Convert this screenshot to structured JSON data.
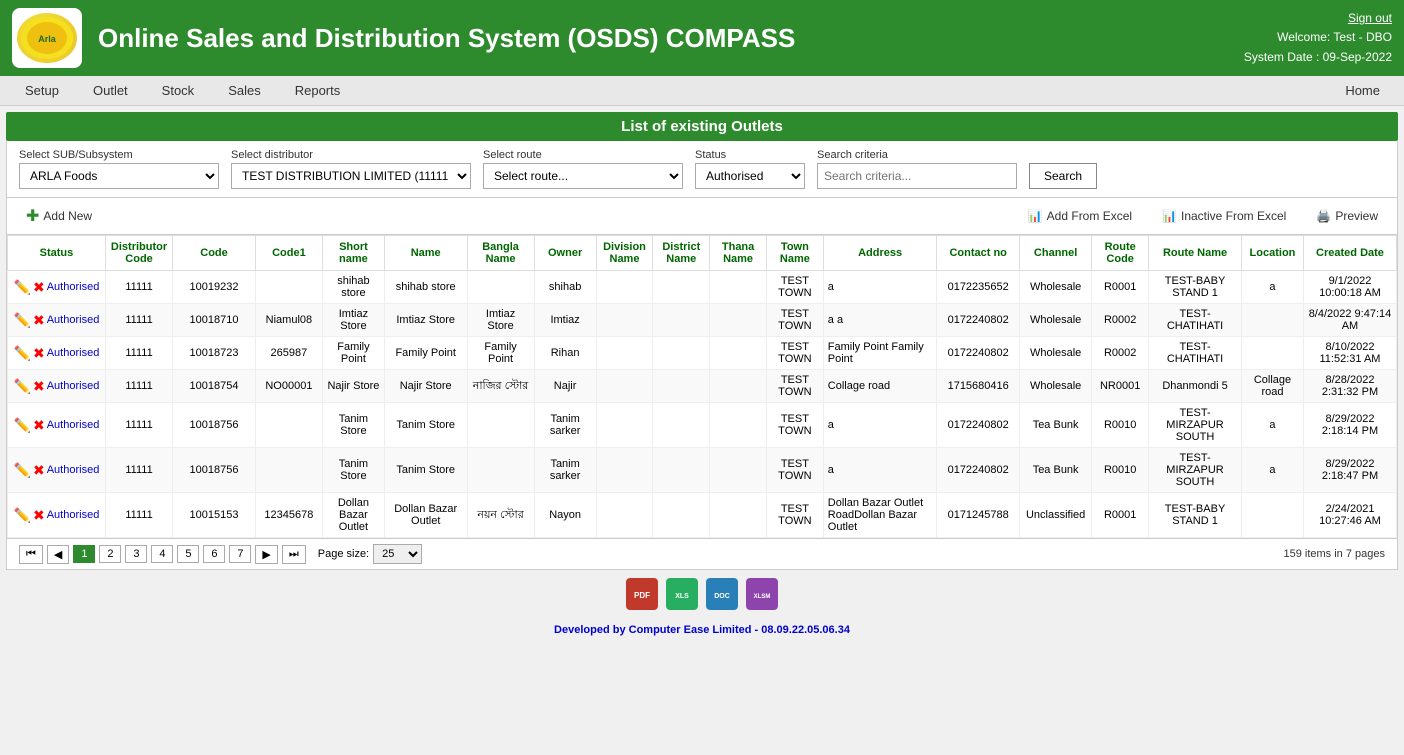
{
  "header": {
    "title": "Online Sales and Distribution System (OSDS) COMPASS",
    "signout": "Sign out",
    "welcome": "Welcome: Test - DBO",
    "system_date": "System Date : 09-Sep-2022",
    "logo_text": "Arla"
  },
  "nav": {
    "items": [
      "Setup",
      "Outlet",
      "Stock",
      "Sales",
      "Reports"
    ],
    "home": "Home"
  },
  "page_title": "List of existing Outlets",
  "filters": {
    "sub_label": "Select SUB/Subsystem",
    "sub_value": "ARLA Foods",
    "dist_label": "Select distributor",
    "dist_value": "TEST DISTRIBUTION LIMITED (11111)",
    "route_label": "Select route",
    "route_placeholder": "Select route...",
    "status_label": "Status",
    "status_value": "Authorised",
    "criteria_label": "Search criteria",
    "criteria_placeholder": "Search criteria...",
    "search_btn": "Search"
  },
  "toolbar": {
    "add_new": "Add New",
    "add_from_excel": "Add From Excel",
    "inactive_from_excel": "Inactive From Excel",
    "preview": "Preview"
  },
  "table": {
    "headers": [
      "Status",
      "Distributor Code",
      "Code",
      "Code1",
      "Short name",
      "Name",
      "Bangla Name",
      "Owner",
      "Division Name",
      "District Name",
      "Thana Name",
      "Town Name",
      "Address",
      "Contact no",
      "Channel",
      "Route Code",
      "Route Name",
      "Location",
      "Created Date"
    ],
    "rows": [
      {
        "status": "Authorised",
        "dist_code": "11111",
        "code": "10019232",
        "code1": "",
        "short": "shihab store",
        "name": "shihab store",
        "bangla": "",
        "owner": "shihab",
        "division": "",
        "district": "",
        "thana": "",
        "town": "TEST TOWN",
        "address": "a",
        "contact": "0172235652",
        "channel": "Wholesale",
        "route_code": "R0001",
        "route_name": "TEST-BABY STAND 1",
        "location": "a",
        "created": "9/1/2022 10:00:18 AM"
      },
      {
        "status": "Authorised",
        "dist_code": "11111",
        "code": "10018710",
        "code1": "Niamul08",
        "short": "Imtiaz Store",
        "name": "Imtiaz Store",
        "bangla": "Imtiaz Store",
        "owner": "Imtiaz",
        "division": "",
        "district": "",
        "thana": "",
        "town": "TEST TOWN",
        "address": "a a",
        "contact": "0172240802",
        "channel": "Wholesale",
        "route_code": "R0002",
        "route_name": "TEST-CHATIHATI",
        "location": "",
        "created": "8/4/2022 9:47:14 AM"
      },
      {
        "status": "Authorised",
        "dist_code": "11111",
        "code": "10018723",
        "code1": "265987",
        "short": "Family Point",
        "name": "Family Point",
        "bangla": "Family Point",
        "owner": "Rihan",
        "division": "",
        "district": "",
        "thana": "",
        "town": "TEST TOWN",
        "address": "Family Point Family Point",
        "contact": "0172240802",
        "channel": "Wholesale",
        "route_code": "R0002",
        "route_name": "TEST-CHATIHATI",
        "location": "",
        "created": "8/10/2022 11:52:31 AM"
      },
      {
        "status": "Authorised",
        "dist_code": "11111",
        "code": "10018754",
        "code1": "NO00001",
        "short": "Najir Store",
        "name": "Najir Store",
        "bangla": "নাজির স্টোর",
        "owner": "Najir",
        "division": "",
        "district": "",
        "thana": "",
        "town": "TEST TOWN",
        "address": "Collage road",
        "contact": "1715680416",
        "channel": "Wholesale",
        "route_code": "NR0001",
        "route_name": "Dhanmondi 5",
        "location": "Collage road",
        "created": "8/28/2022 2:31:32 PM"
      },
      {
        "status": "Authorised",
        "dist_code": "11111",
        "code": "10018756",
        "code1": "",
        "short": "Tanim Store",
        "name": "Tanim Store",
        "bangla": "",
        "owner": "Tanim sarker",
        "division": "",
        "district": "",
        "thana": "",
        "town": "TEST TOWN",
        "address": "a",
        "contact": "0172240802",
        "channel": "Tea Bunk",
        "route_code": "R0010",
        "route_name": "TEST-MIRZAPUR SOUTH",
        "location": "a",
        "created": "8/29/2022 2:18:14 PM"
      },
      {
        "status": "Authorised",
        "dist_code": "11111",
        "code": "10018756",
        "code1": "",
        "short": "Tanim Store",
        "name": "Tanim Store",
        "bangla": "",
        "owner": "Tanim sarker",
        "division": "",
        "district": "",
        "thana": "",
        "town": "TEST TOWN",
        "address": "a",
        "contact": "0172240802",
        "channel": "Tea Bunk",
        "route_code": "R0010",
        "route_name": "TEST-MIRZAPUR SOUTH",
        "location": "a",
        "created": "8/29/2022 2:18:47 PM"
      },
      {
        "status": "Authorised",
        "dist_code": "11111",
        "code": "10015153",
        "code1": "12345678",
        "short": "Dollan Bazar Outlet",
        "name": "Dollan Bazar Outlet",
        "bangla": "নয়ন স্টোর",
        "owner": "Nayon",
        "division": "",
        "district": "",
        "thana": "",
        "town": "TEST TOWN",
        "address": "Dollan Bazar Outlet RoadDollan Bazar Outlet",
        "contact": "0171245788",
        "channel": "Unclassified",
        "route_code": "R0001",
        "route_name": "TEST-BABY STAND 1",
        "location": "",
        "created": "2/24/2021 10:27:46 AM"
      }
    ]
  },
  "pagination": {
    "pages": [
      "1",
      "2",
      "3",
      "4",
      "5",
      "6",
      "7"
    ],
    "current": "1",
    "page_size_label": "Page size:",
    "page_size": "25",
    "total": "159 items in 7 pages"
  },
  "export": {
    "pdf": "PDF",
    "excel": "XLS",
    "word": "DOC",
    "xlsm": "XLSM"
  },
  "footer": {
    "text": "Developed by Computer Ease Limited",
    "version": " - 08.09.22.05.06.34"
  }
}
